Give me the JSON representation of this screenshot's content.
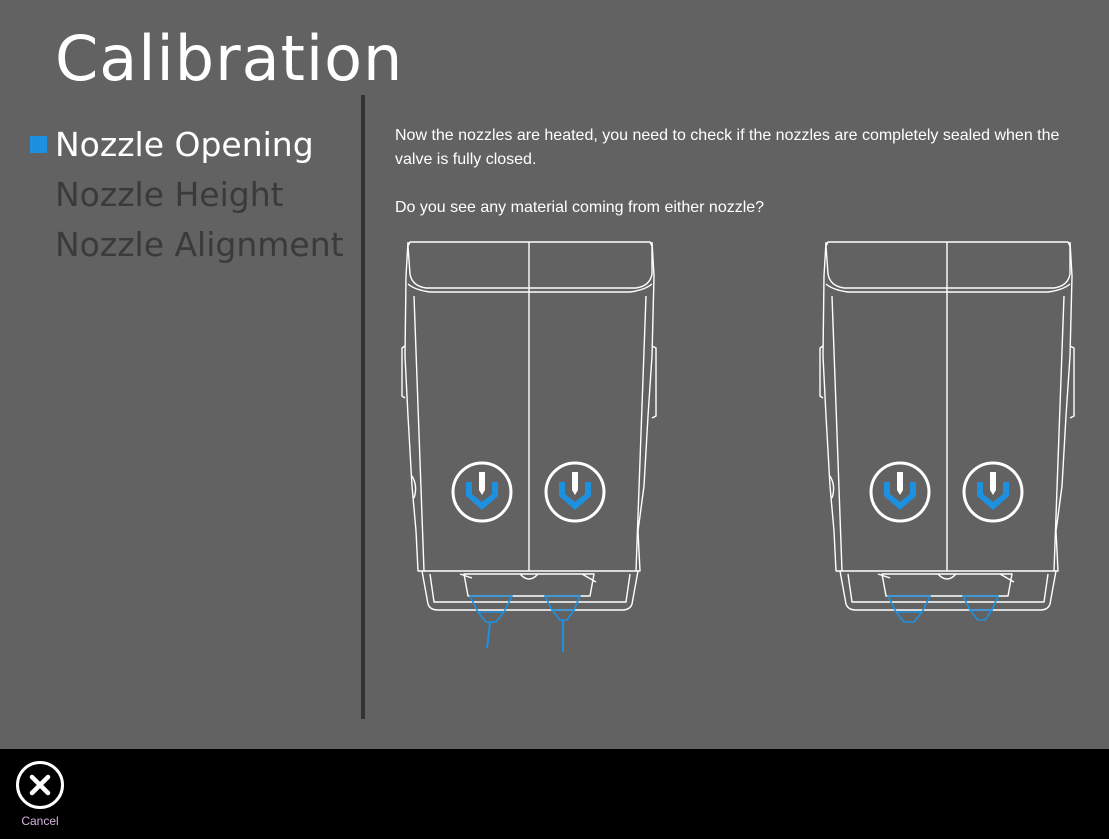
{
  "page": {
    "title": "Calibration"
  },
  "steps": [
    {
      "label": "Nozzle Opening",
      "active": true
    },
    {
      "label": "Nozzle Height",
      "active": false
    },
    {
      "label": "Nozzle Alignment",
      "active": false
    }
  ],
  "instructions": {
    "paragraph1": "Now the nozzles are heated, you need to check if the nozzles are completely sealed when the valve is fully closed.",
    "question": "Do you see any material coming from either nozzle?"
  },
  "options": [
    {
      "name": "material-leaking-option",
      "icon": "printhead-with-leaking-nozzles-icon"
    },
    {
      "name": "no-material-option",
      "icon": "printhead-sealed-nozzles-icon"
    }
  ],
  "footer": {
    "cancel_label": "Cancel",
    "cancel_icon": "close-icon"
  },
  "colors": {
    "background": "#626262",
    "accent": "#1e90e0",
    "footer": "#000000",
    "inactive_step": "#3a3a3a"
  }
}
